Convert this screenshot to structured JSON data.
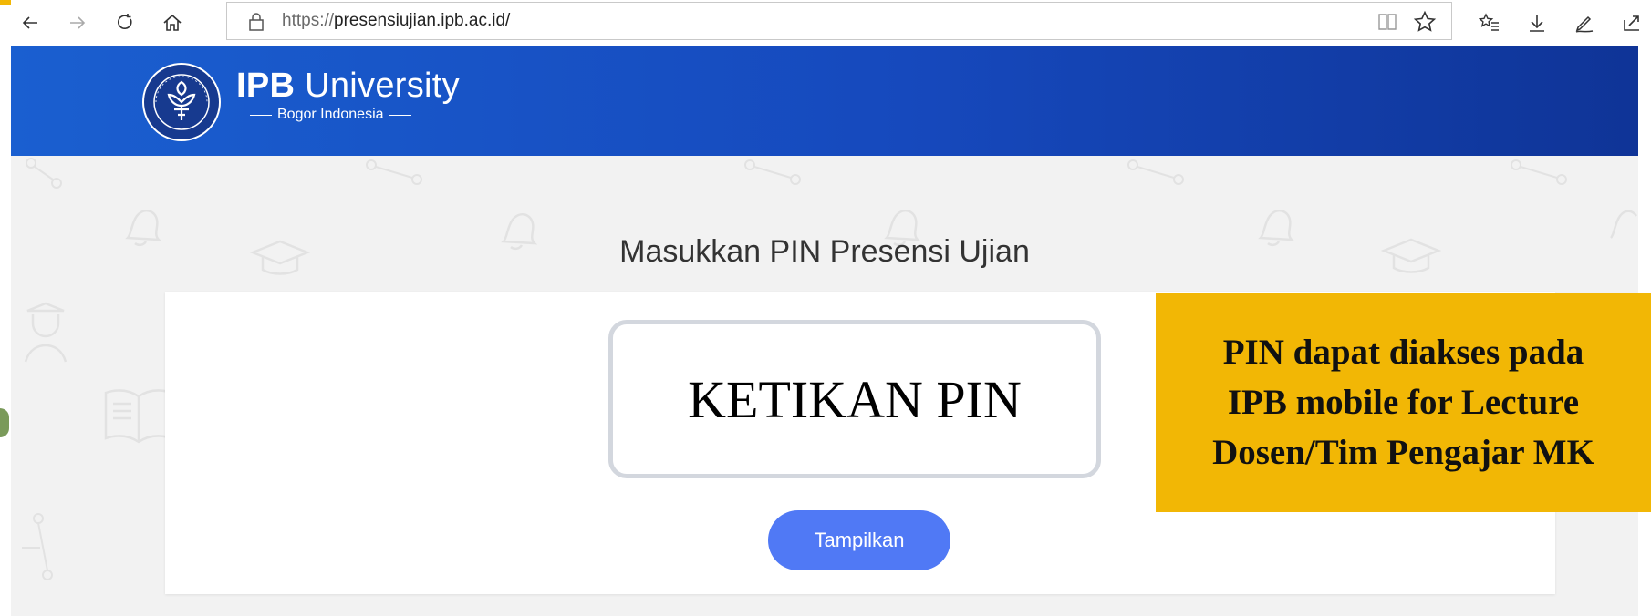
{
  "browser": {
    "url_scheme": "https://",
    "url_host": "presensiujian.ipb.ac.id/",
    "icons": [
      "back-icon",
      "forward-icon",
      "refresh-icon",
      "home-icon",
      "lock-icon",
      "reader-view-icon",
      "favorite-star-icon",
      "favorites-list-icon",
      "download-icon",
      "pen-icon",
      "share-icon"
    ]
  },
  "header": {
    "brand_bold": "IPB",
    "brand_rest": "University",
    "brand_sub": "Bogor Indonesia"
  },
  "main": {
    "title": "Masukkan PIN Presensi Ujian",
    "pin_placeholder": "KETIKAN PIN",
    "submit_label": "Tampilkan"
  },
  "callout": {
    "text": "PIN dapat diakses pada IPB mobile for Lecture Dosen/Tim Pengajar MK"
  },
  "colors": {
    "header_blue": "#1649bd",
    "button_blue": "#5079f5",
    "callout_yellow": "#f2b705"
  }
}
